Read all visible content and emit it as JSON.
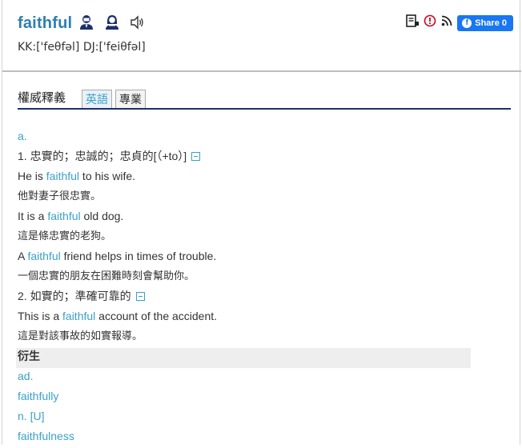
{
  "entry": {
    "word": "faithful",
    "pronunciation": "KK:['feθfəl] DJ:['feiθfəl]"
  },
  "toolbar": {
    "share_label": "Share 0"
  },
  "tabs": {
    "title": "權威釋義",
    "items": [
      {
        "label": "英語"
      },
      {
        "label": "專業"
      }
    ]
  },
  "definitions": {
    "pos_adj": "a.",
    "sense1": "1. 忠實的；忠誠的；忠貞的[（+to）]",
    "ex1_pre": "He is ",
    "ex1_hl": "faithful",
    "ex1_post": " to his wife.",
    "ex1_zh": "他對妻子很忠實。",
    "ex2_pre": "It is a ",
    "ex2_hl": "faithful",
    "ex2_post": " old dog.",
    "ex2_zh": "這是條忠實的老狗。",
    "ex3_pre": "A ",
    "ex3_hl": "faithful",
    "ex3_post": " friend helps in times of trouble.",
    "ex3_zh": "一個忠實的朋友在困難時刻會幫助你。",
    "sense2": "2. 如實的；準確可靠的",
    "ex4_pre": "This is a ",
    "ex4_hl": "faithful",
    "ex4_post": " account of the accident.",
    "ex4_zh": "這是對該事故的如實報導。",
    "derived_title": "衍生",
    "pos_adv": "ad.",
    "adv_word": "faithfully",
    "pos_noun": "n. [U]",
    "noun_word": "faithfulness"
  },
  "colors": {
    "word": "#2e7fb1",
    "highlight": "#3aa0c8",
    "underline": "#1b2f6b",
    "share_bg": "#1877f2"
  }
}
